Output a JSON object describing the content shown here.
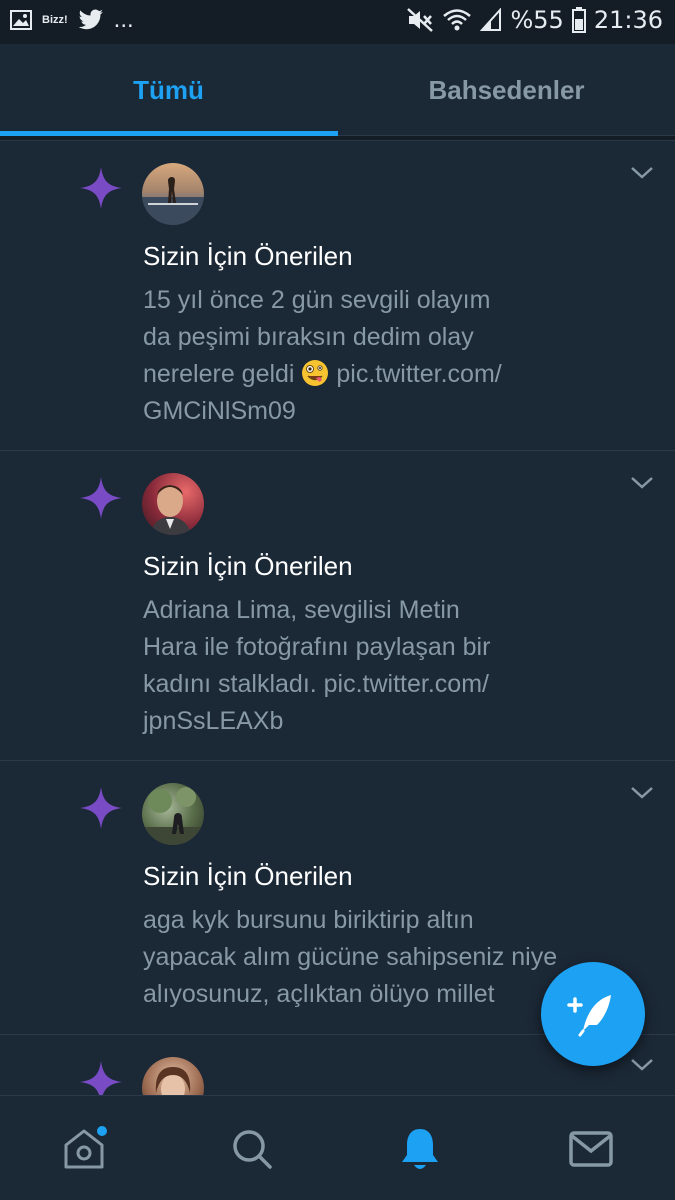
{
  "status_bar": {
    "notif_bizz": "Bizz!",
    "dots": "...",
    "battery_percent": "%55",
    "time": "21:36"
  },
  "tabs": [
    {
      "label": "Tümü",
      "active": true
    },
    {
      "label": "Bahsedenler",
      "active": false
    }
  ],
  "notifications": [
    {
      "title": "Sizin İçin Önerilen",
      "body_lines": [
        "15 yıl önce 2 gün sevgili olayım",
        "da peşimi bıraksın dedim olay",
        "nerelere geldi",
        "GMCiNlSm09"
      ],
      "link_after_emoji": "pic.twitter.com/",
      "emoji": "zany-face-emoji"
    },
    {
      "title": "Sizin İçin Önerilen",
      "body_lines": [
        "Adriana Lima, sevgilisi Metin",
        "Hara ile fotoğrafını paylaşan bir",
        "kadını stalkladı. pic.twitter.com/",
        "jpnSsLEAXb"
      ]
    },
    {
      "title": "Sizin İçin Önerilen",
      "body_lines": [
        "aga kyk bursunu biriktirip altın",
        "yapacak alım gücüne sahipseniz niye",
        "alıyosunuz, açlıktan ölüyo millet"
      ]
    }
  ],
  "colors": {
    "accent": "#1da1f2",
    "sparkle": "#794bc4",
    "background": "#1b2836",
    "muted_text": "#8899a6"
  },
  "bottom_nav": [
    "home-icon",
    "search-icon",
    "bell-icon",
    "mail-icon"
  ]
}
